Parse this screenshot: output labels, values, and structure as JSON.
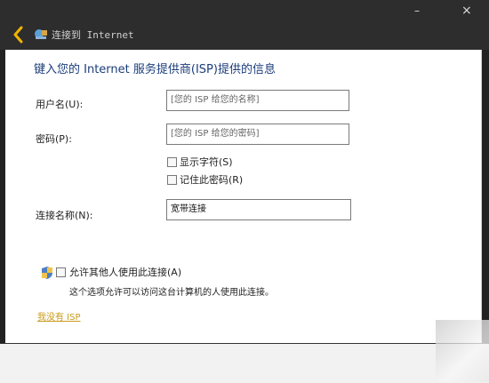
{
  "window": {
    "title": "连接到 Internet",
    "minimize": "–",
    "close": "×"
  },
  "form": {
    "heading": "键入您的 Internet 服务提供商(ISP)提供的信息",
    "username_label": "用户名(U):",
    "username_placeholder": "[您的 ISP 给您的名称]",
    "password_label": "密码(P):",
    "password_placeholder": "[您的 ISP 给您的密码]",
    "show_chars_label": "显示字符(S)",
    "remember_password_label": "记住此密码(R)",
    "connection_name_label": "连接名称(N):",
    "connection_name_value": "宽带连接",
    "allow_others_label": "允许其他人使用此连接(A)",
    "allow_others_note": "这个选项允许可以访问这台计算机的人使用此连接。",
    "no_isp_link": "我没有 ISP"
  },
  "icons": {
    "back": "back-arrow-icon",
    "app": "network-icon",
    "shield": "security-shield-icon"
  },
  "colors": {
    "accent": "#f0b400",
    "heading": "#1b3d7a",
    "link": "#c99a1b"
  }
}
